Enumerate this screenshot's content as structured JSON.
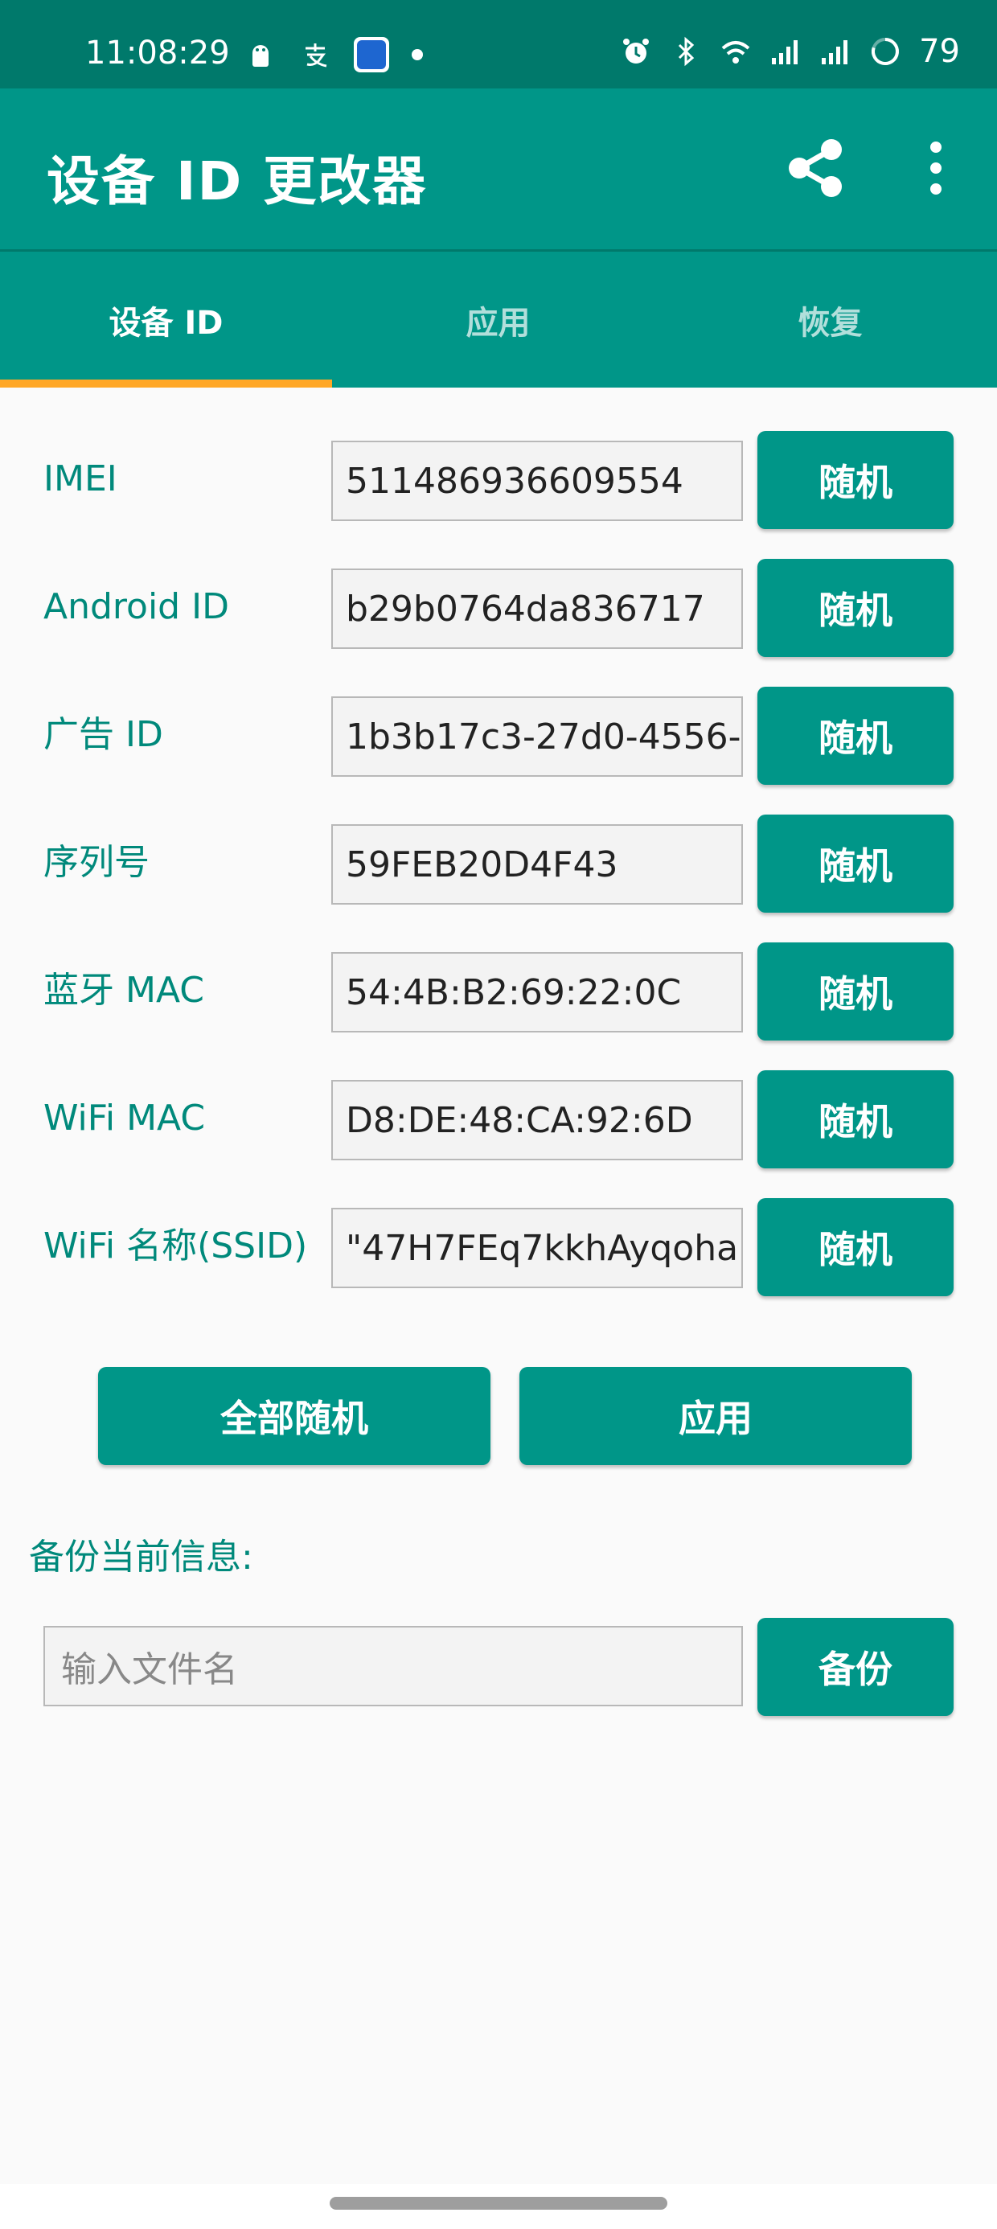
{
  "status_bar": {
    "time": "11:08:29",
    "battery": "79"
  },
  "app_bar": {
    "title": "设备 ID 更改器"
  },
  "tabs": [
    {
      "label": "设备 ID",
      "active": true
    },
    {
      "label": "应用",
      "active": false
    },
    {
      "label": "恢复",
      "active": false
    }
  ],
  "rows": [
    {
      "label": "IMEI",
      "value": "511486936609554",
      "button": "随机"
    },
    {
      "label": "Android ID",
      "value": "b29b0764da836717",
      "button": "随机"
    },
    {
      "label": "广告 ID",
      "value": "1b3b17c3-27d0-4556-",
      "button": "随机"
    },
    {
      "label": "序列号",
      "value": "59FEB20D4F43",
      "button": "随机"
    },
    {
      "label": "蓝牙 MAC",
      "value": "54:4B:B2:69:22:0C",
      "button": "随机"
    },
    {
      "label": "WiFi MAC",
      "value": "D8:DE:48:CA:92:6D",
      "button": "随机"
    },
    {
      "label": "WiFi 名称(SSID)",
      "value": "\"47H7FEq7kkhAyqoha",
      "button": "随机"
    }
  ],
  "actions": {
    "randomize_all": "全部随机",
    "apply": "应用"
  },
  "backup": {
    "label": "备份当前信息:",
    "placeholder": "输入文件名",
    "button": "备份"
  },
  "colors": {
    "status_bar": "#00796b",
    "primary": "#009688",
    "accent": "#ffa726",
    "label_text": "#00897b"
  }
}
